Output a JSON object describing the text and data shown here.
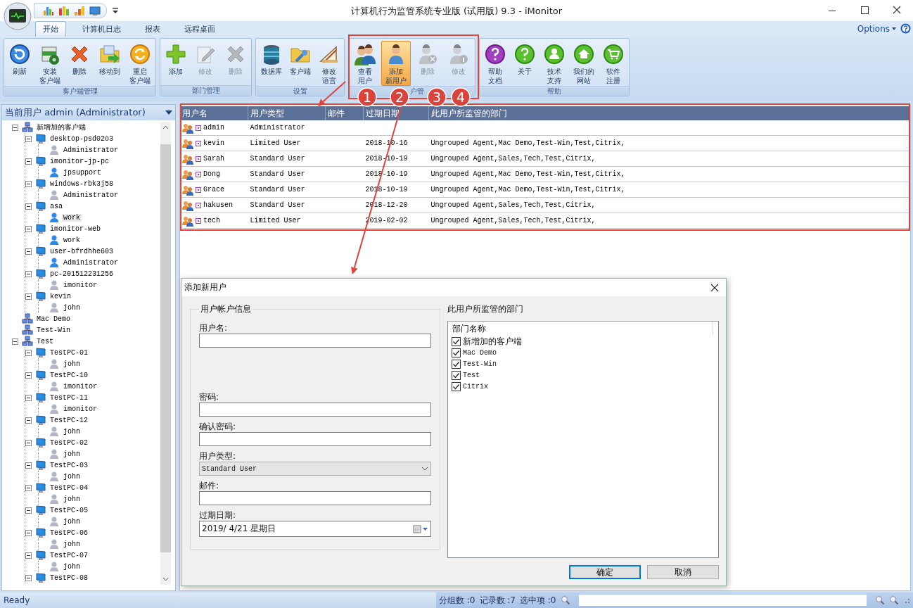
{
  "window": {
    "title": "计算机行为监管系统专业版 (试用版) 9.3 - iMonitor"
  },
  "tabs": [
    {
      "label": "开始",
      "selected": true
    },
    {
      "label": "计算机日志",
      "selected": false
    },
    {
      "label": "报表",
      "selected": false
    },
    {
      "label": "远程桌面",
      "selected": false
    }
  ],
  "options": {
    "label": "Options"
  },
  "ribbon": {
    "groups": [
      {
        "label": "客户端管理",
        "buttons": [
          {
            "lines": [
              "刷新"
            ],
            "disabled": false,
            "highlighted": false
          },
          {
            "lines": [
              "安装",
              "客户端"
            ],
            "disabled": false,
            "highlighted": false
          },
          {
            "lines": [
              "删除"
            ],
            "disabled": false,
            "highlighted": false
          },
          {
            "lines": [
              "移动到"
            ],
            "disabled": false,
            "highlighted": false
          },
          {
            "lines": [
              "重启",
              "客户端"
            ],
            "disabled": false,
            "highlighted": false
          }
        ]
      },
      {
        "label": "部门管理",
        "buttons": [
          {
            "lines": [
              "添加"
            ],
            "disabled": false,
            "highlighted": false
          },
          {
            "lines": [
              "修改"
            ],
            "disabled": true,
            "highlighted": false
          },
          {
            "lines": [
              "删除"
            ],
            "disabled": true,
            "highlighted": false
          }
        ]
      },
      {
        "label": "设置",
        "buttons": [
          {
            "lines": [
              "数据库"
            ],
            "disabled": false,
            "highlighted": false
          },
          {
            "lines": [
              "客户端"
            ],
            "disabled": false,
            "highlighted": false
          },
          {
            "lines": [
              "修改",
              "语言"
            ],
            "disabled": false,
            "highlighted": false
          }
        ]
      },
      {
        "label": "户管",
        "buttons": [
          {
            "lines": [
              "查看",
              "用户"
            ],
            "disabled": false,
            "highlighted": false
          },
          {
            "lines": [
              "添加",
              "新用户"
            ],
            "disabled": false,
            "highlighted": true
          },
          {
            "lines": [
              "删除"
            ],
            "disabled": true,
            "highlighted": false
          },
          {
            "lines": [
              "修改"
            ],
            "disabled": true,
            "highlighted": false
          }
        ]
      },
      {
        "label": "帮助",
        "buttons": [
          {
            "lines": [
              "帮助",
              "文档"
            ],
            "disabled": false,
            "highlighted": false
          },
          {
            "lines": [
              "关于"
            ],
            "disabled": false,
            "highlighted": false
          },
          {
            "lines": [
              "技术",
              "支持"
            ],
            "disabled": false,
            "highlighted": false
          },
          {
            "lines": [
              "我们的",
              "网站"
            ],
            "disabled": false,
            "highlighted": false
          },
          {
            "lines": [
              "软件",
              "注册"
            ],
            "disabled": false,
            "highlighted": false
          }
        ]
      }
    ]
  },
  "annotations": {
    "callouts": [
      "1",
      "2",
      "3",
      "4"
    ]
  },
  "tree": {
    "header": "当前用户 admin (Administrator)",
    "nodes": [
      {
        "label": "新增加的客户端",
        "kind": "group",
        "expanded": true,
        "selected": false,
        "children": [
          {
            "label": "desktop-psd02o3",
            "kind": "computer",
            "expanded": true,
            "selected": false,
            "children": [
              {
                "label": "Administrator",
                "kind": "user",
                "active": false,
                "selected": false
              }
            ]
          },
          {
            "label": "imonitor-jp-pc",
            "kind": "computer",
            "expanded": true,
            "selected": false,
            "children": [
              {
                "label": "jpsupport",
                "kind": "user",
                "active": true,
                "selected": false
              }
            ]
          },
          {
            "label": "windows-rbk3j58",
            "kind": "computer",
            "expanded": true,
            "selected": false,
            "children": [
              {
                "label": "Administrator",
                "kind": "user",
                "active": false,
                "selected": false
              }
            ]
          },
          {
            "label": "asa",
            "kind": "computer",
            "expanded": true,
            "selected": false,
            "children": [
              {
                "label": "work",
                "kind": "user",
                "active": true,
                "selected": true
              }
            ]
          },
          {
            "label": "imonitor-web",
            "kind": "computer",
            "expanded": true,
            "selected": false,
            "children": [
              {
                "label": "work",
                "kind": "user",
                "active": true,
                "selected": false
              }
            ]
          },
          {
            "label": "user-bfrdhhe603",
            "kind": "computer",
            "expanded": true,
            "selected": false,
            "children": [
              {
                "label": "Administrator",
                "kind": "user",
                "active": true,
                "selected": false
              }
            ]
          },
          {
            "label": "pc-201512231256",
            "kind": "computer",
            "expanded": true,
            "selected": false,
            "children": [
              {
                "label": "imonitor",
                "kind": "user",
                "active": false,
                "selected": false
              }
            ]
          },
          {
            "label": "kevin",
            "kind": "computer",
            "expanded": true,
            "selected": false,
            "children": [
              {
                "label": "john",
                "kind": "user",
                "active": false,
                "selected": false
              }
            ]
          }
        ]
      },
      {
        "label": "Mac Demo",
        "kind": "group",
        "selected": false
      },
      {
        "label": "Test-Win",
        "kind": "group",
        "selected": false
      },
      {
        "label": "Test",
        "kind": "group",
        "expanded": true,
        "selected": false,
        "children": [
          {
            "label": "TestPC-01",
            "kind": "computer",
            "expanded": true,
            "selected": false,
            "children": [
              {
                "label": "john",
                "kind": "user",
                "active": false,
                "selected": false
              }
            ]
          },
          {
            "label": "TestPC-10",
            "kind": "computer",
            "expanded": true,
            "selected": false,
            "children": [
              {
                "label": "imonitor",
                "kind": "user",
                "active": false,
                "selected": false
              }
            ]
          },
          {
            "label": "TestPC-11",
            "kind": "computer",
            "expanded": true,
            "selected": false,
            "children": [
              {
                "label": "imonitor",
                "kind": "user",
                "active": false,
                "selected": false
              }
            ]
          },
          {
            "label": "TestPC-12",
            "kind": "computer",
            "expanded": true,
            "selected": false,
            "children": [
              {
                "label": "john",
                "kind": "user",
                "active": false,
                "selected": false
              }
            ]
          },
          {
            "label": "TestPC-02",
            "kind": "computer",
            "expanded": true,
            "selected": false,
            "children": [
              {
                "label": "john",
                "kind": "user",
                "active": false,
                "selected": false
              }
            ]
          },
          {
            "label": "TestPC-03",
            "kind": "computer",
            "expanded": true,
            "selected": false,
            "children": [
              {
                "label": "john",
                "kind": "user",
                "active": false,
                "selected": false
              }
            ]
          },
          {
            "label": "TestPC-04",
            "kind": "computer",
            "expanded": true,
            "selected": false,
            "children": [
              {
                "label": "john",
                "kind": "user",
                "active": false,
                "selected": false
              }
            ]
          },
          {
            "label": "TestPC-05",
            "kind": "computer",
            "expanded": true,
            "selected": false,
            "children": [
              {
                "label": "john",
                "kind": "user",
                "active": false,
                "selected": false
              }
            ]
          },
          {
            "label": "TestPC-06",
            "kind": "computer",
            "expanded": true,
            "selected": false,
            "children": [
              {
                "label": "john",
                "kind": "user",
                "active": false,
                "selected": false
              }
            ]
          },
          {
            "label": "TestPC-07",
            "kind": "computer",
            "expanded": true,
            "selected": false,
            "children": [
              {
                "label": "john",
                "kind": "user",
                "active": false,
                "selected": false
              }
            ]
          },
          {
            "label": "TestPC-08",
            "kind": "computer",
            "expanded": true,
            "selected": false
          }
        ]
      }
    ]
  },
  "table": {
    "columns": [
      "用户名",
      "用户类型",
      "邮件",
      "过期日期",
      "此用户所监管的部门"
    ],
    "rows": [
      {
        "name": "admin",
        "type": "Administrator"
      },
      {
        "name": "kevin",
        "type": "Limited User",
        "expires": "2018-10-16",
        "departments": "Ungrouped Agent,Mac Demo,Test-Win,Test,Citrix,"
      },
      {
        "name": "Sarah",
        "type": "Standard User",
        "expires": "2018-10-19",
        "departments": "Ungrouped Agent,Sales,Tech,Test,Citrix,"
      },
      {
        "name": "Dong",
        "type": "Standard User",
        "expires": "2018-10-19",
        "departments": "Ungrouped Agent,Mac Demo,Test-Win,Test,Citrix,"
      },
      {
        "name": "Grace",
        "type": "Standard User",
        "expires": "2018-10-19",
        "departments": "Ungrouped Agent,Mac Demo,Test-Win,Test,Citrix,"
      },
      {
        "name": "hakusen",
        "type": "Standard User",
        "expires": "2018-12-20",
        "departments": "Ungrouped Agent,Sales,Tech,Test,Citrix,"
      },
      {
        "name": "tech",
        "type": "Limited User",
        "expires": "2019-02-02",
        "departments": "Ungrouped Agent,Sales,Tech,Test,Citrix,"
      }
    ]
  },
  "dialog": {
    "title": "添加新用户",
    "account_group": "用户帐户信息",
    "fields": [
      {
        "label": "用户名:",
        "kind": "text"
      },
      {
        "label": "密码:",
        "kind": "text"
      },
      {
        "label": "确认密码:",
        "kind": "text"
      },
      {
        "label": "用户类型:",
        "kind": "select",
        "value": "Standard User"
      },
      {
        "label": "邮件:",
        "kind": "text"
      },
      {
        "label": "过期日期:",
        "kind": "date",
        "value": "2019/ 4/21 星期日"
      }
    ],
    "departments_title": "此用户所监管的部门",
    "departments_column": "部门名称",
    "departments": [
      {
        "label": "新增加的客户端",
        "checked": true
      },
      {
        "label": "Mac Demo",
        "checked": true
      },
      {
        "label": "Test-Win",
        "checked": true
      },
      {
        "label": "Test",
        "checked": true
      },
      {
        "label": "Citrix",
        "checked": true
      }
    ],
    "buttons": [
      {
        "label": "确定",
        "default": true
      },
      {
        "label": "取消",
        "default": false
      }
    ]
  },
  "status_bar": {
    "ready": "Ready",
    "counts": [
      "分组数 :0",
      "记录数 :7",
      "选中项 :0"
    ]
  }
}
